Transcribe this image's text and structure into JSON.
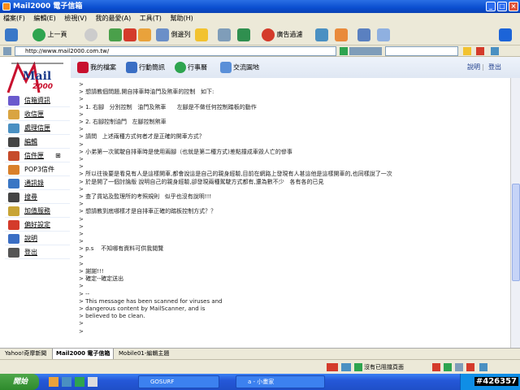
{
  "window": {
    "title": "Mail2000 電子信箱"
  },
  "menu": [
    "檔案(F)",
    "編輯(E)",
    "檢視(V)",
    "我的最愛(A)",
    "工具(T)",
    "幫助(H)"
  ],
  "toolbar": {
    "prev": "上一頁",
    "columns": "側邊列",
    "ads": "廣告過濾"
  },
  "address": {
    "url": "http://www.mail2000.com.tw/"
  },
  "logo": {
    "text": "Mail",
    "sub": "2000"
  },
  "topnav": {
    "files": "我的檔案",
    "mobile": "行動簡訊",
    "calendar": "行事曆",
    "community": "交流園地",
    "help": "說明",
    "logout": "登出"
  },
  "sidebar": [
    {
      "label": "信箱資訊",
      "color": "#6a5acd"
    },
    {
      "label": "收信匣",
      "color": "#d9a441"
    },
    {
      "label": "處理信匣",
      "color": "#4a90c2"
    },
    {
      "label": "編輯",
      "color": "#444"
    },
    {
      "label": "信件匣",
      "color": "#c64b2b"
    },
    {
      "label": "POP3信件",
      "color": "#d9802a"
    },
    {
      "label": "通訊錄",
      "color": "#3a76c4"
    },
    {
      "label": "搜尋",
      "color": "#444"
    },
    {
      "label": "加值服務",
      "color": "#c8a436"
    },
    {
      "label": "偏好設定",
      "color": "#d43b2b"
    },
    {
      "label": "說明",
      "color": "#3a6ec4"
    },
    {
      "label": "登出",
      "color": "#555"
    }
  ],
  "message": [
    ">",
    "> 想請教個問題,開自排車時油門及煞車的控制   如下:",
    ">",
    "> 1. 右腳   分別控制   油門及煞車      左腳是不做任何控制踏板的動作",
    ">",
    "> 2. 右腳控制油門   左腳控制煞車",
    ">",
    "> 請問   上述兩種方式何者才是正確的開車方式？",
    ">",
    "> 小弟第一次駕駛自排車時是使用兩腳（也就是第二種方式)差點撞成車毀人亡的慘事",
    ">",
    ">",
    "> 所以往後要是看見有人是這樣開車,都會說這是自己的親身經驗,目前在網路上發現有人甚這他是這樣開車的,也同樣說了一次",
    "> 於是開了一個討論版 說明自己的親身經驗,卻發現兩種駕駛方式都有,還為數不少   各有各的已見",
    ">",
    "> 查了貨站及監理所的考照規則   似乎也沒有說明!!!",
    ">",
    "> 想請教到底哪樣才是自排車正確的踏板控制方式？？",
    ">",
    ">",
    ">",
    ">",
    "> p.s    不知哪有資料可供我閱覽",
    ">",
    ">",
    "> 謝謝!!!",
    "> 確定--確定送出",
    ">",
    "> --",
    "> This message has been scanned for viruses and",
    "> dangerous content by MailScanner, and is",
    "> believed to be clean.",
    ">",
    ">"
  ],
  "tabs": [
    "Yahoo!奇摩新聞",
    "Mail2000 電子信箱",
    "Mobile01-編輯主題"
  ],
  "status": {
    "popup": "沒有已阻擋頁面"
  },
  "taskbar": {
    "start": "開始",
    "task1": "GOSURF",
    "task2": "a - 小畫家"
  },
  "watermark": "#426357"
}
